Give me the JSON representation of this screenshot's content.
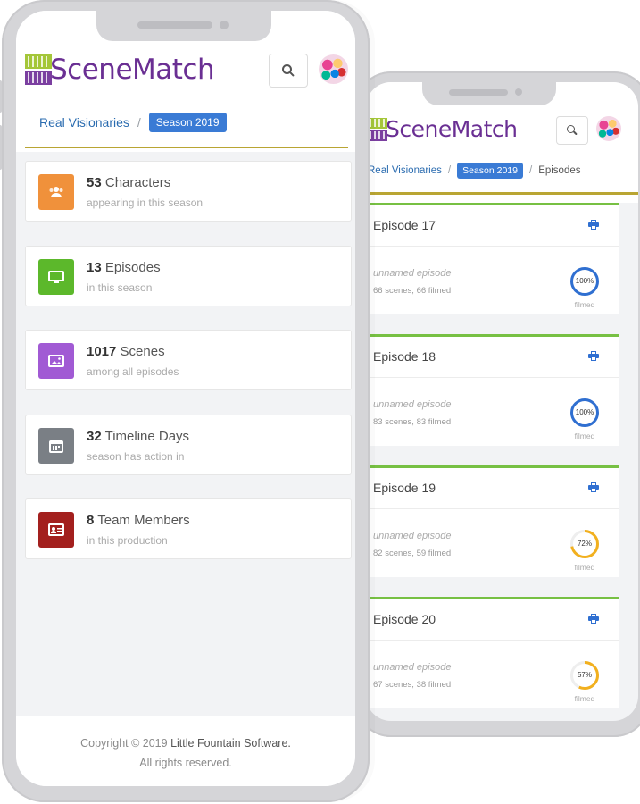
{
  "app": {
    "logo_text": "SceneMatch"
  },
  "breadcrumb": {
    "project": "Real Visionaries",
    "separator": "/",
    "season": "Season 2019",
    "current": "Episodes"
  },
  "stats": [
    {
      "count": "53",
      "label": "Characters",
      "sub": "appearing in this season",
      "color": "#f0913b",
      "icon": "users-icon"
    },
    {
      "count": "13",
      "label": "Episodes",
      "sub": "in this season",
      "color": "#5cb82b",
      "icon": "monitor-icon"
    },
    {
      "count": "1017",
      "label": "Scenes",
      "sub": "among all episodes",
      "color": "#a15ad4",
      "icon": "image-icon"
    },
    {
      "count": "32",
      "label": "Timeline Days",
      "sub": "season has action in",
      "color": "#7a7f85",
      "icon": "calendar-icon"
    },
    {
      "count": "8",
      "label": "Team Members",
      "sub": "in this production",
      "color": "#a3201e",
      "icon": "id-card-icon"
    }
  ],
  "footer": {
    "line1_prefix": "Copyright © 2019",
    "brand": "Little Fountain Software.",
    "line2": "All rights reserved."
  },
  "episodes": [
    {
      "title": "Episode 17",
      "name": "unnamed episode",
      "scenes": "66 scenes, 66 filmed",
      "percent_label": "100%",
      "progress": 1.0,
      "color": "#2f6fd1",
      "filmed": "filmed"
    },
    {
      "title": "Episode 18",
      "name": "unnamed episode",
      "scenes": "83 scenes, 83 filmed",
      "percent_label": "100%",
      "progress": 1.0,
      "color": "#2f6fd1",
      "filmed": "filmed"
    },
    {
      "title": "Episode 19",
      "name": "unnamed episode",
      "scenes": "82 scenes, 59 filmed",
      "percent_label": "72%",
      "progress": 0.72,
      "color": "#f2b01e",
      "filmed": "filmed"
    },
    {
      "title": "Episode 20",
      "name": "unnamed episode",
      "scenes": "67 scenes, 38 filmed",
      "percent_label": "57%",
      "progress": 0.57,
      "color": "#f2b01e",
      "filmed": "filmed"
    }
  ],
  "colors": {
    "accent": "#3a7bd5",
    "logo": "#6a2f93",
    "episode_rule": "#77c043",
    "header_rule": "#b9a533"
  }
}
